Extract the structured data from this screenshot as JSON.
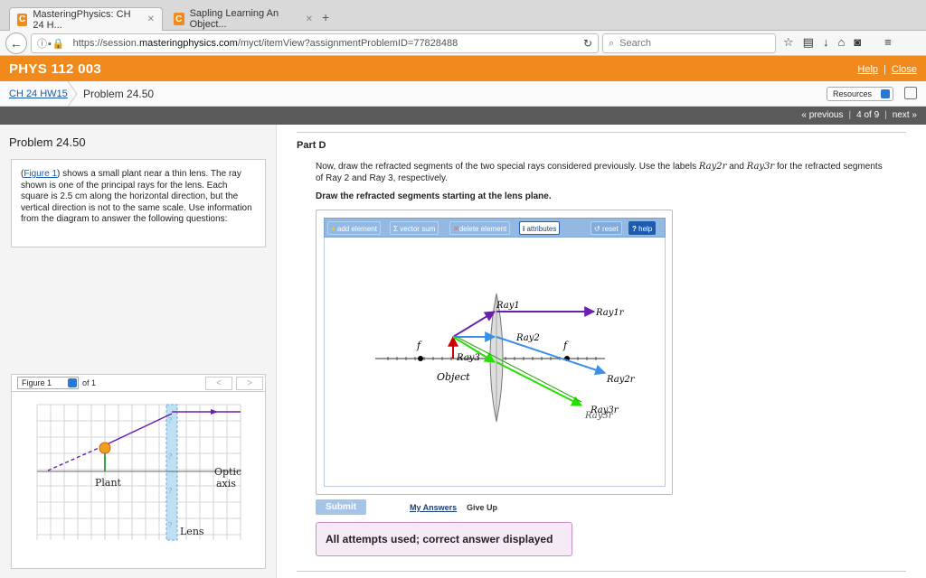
{
  "browser": {
    "tabs": [
      {
        "title": "MasteringPhysics: CH 24 H...",
        "favicon": "C",
        "active": true
      },
      {
        "title": "Sapling Learning An Object...",
        "favicon": "C",
        "active": false
      }
    ],
    "url_prefix": "https://session.",
    "url_domain": "masteringphysics.com",
    "url_path": "/myct/itemView?assignmentProblemID=77828488",
    "search_placeholder": "Search"
  },
  "header": {
    "course": "PHYS 112 003",
    "help": "Help",
    "close": "Close",
    "sep": "|"
  },
  "crumbs": {
    "hw": "CH 24 HW15",
    "problem": "Problem 24.50",
    "resources": "Resources"
  },
  "pager": {
    "previous": "« previous",
    "position": "4 of 9",
    "next": "next »"
  },
  "left": {
    "title": "Problem 24.50",
    "intro_link": "Figure 1",
    "intro_pre": "(",
    "intro_text": ") shows a small plant near a thin lens. The ray shown is one of the principal rays for the lens. Each square is 2.5 cm along the horizontal direction, but the vertical direction is not to the same scale. Use information from the diagram to answer the following questions:",
    "figure_select": "Figure 1",
    "figure_of": "of 1",
    "fig_prev": "<",
    "fig_next": ">",
    "figure_labels": {
      "plant": "Plant",
      "optic1": "Optic",
      "optic2": "axis",
      "lens": "Lens",
      "q": "?"
    }
  },
  "part": {
    "label": "Part D",
    "instr_pre": "Now, draw the refracted segments of the two special rays considered previously. Use the labels ",
    "label_ray2": "Ray2r",
    "and": " and ",
    "label_ray3": "Ray3r",
    "instr_post": " for the refracted segments of Ray 2 and Ray 3, respectively.",
    "instr_bold": "Draw the refracted segments starting at the lens plane."
  },
  "widget": {
    "toolbar": {
      "add": "add element",
      "vsum": "vector sum",
      "del": "delete element",
      "attr": "attributes",
      "reset": "reset",
      "help": "help"
    },
    "labels": {
      "ray1": "Ray1",
      "ray1r": "Ray1r",
      "ray2": "Ray2",
      "ray2r": "Ray2r",
      "ray3": "Ray3",
      "ray3r": "Ray3r",
      "ray3r_b": "Ray3r",
      "f": "f",
      "object": "Object"
    },
    "colors": {
      "ray1": "#6a1fb0",
      "ray2": "#3a8fe6",
      "ray3": "#22e000",
      "object": "#cc0000"
    }
  },
  "actions": {
    "submit": "Submit",
    "my_answers": "My Answers",
    "give_up": "Give Up",
    "feedback": "All attempts used; correct answer displayed"
  }
}
